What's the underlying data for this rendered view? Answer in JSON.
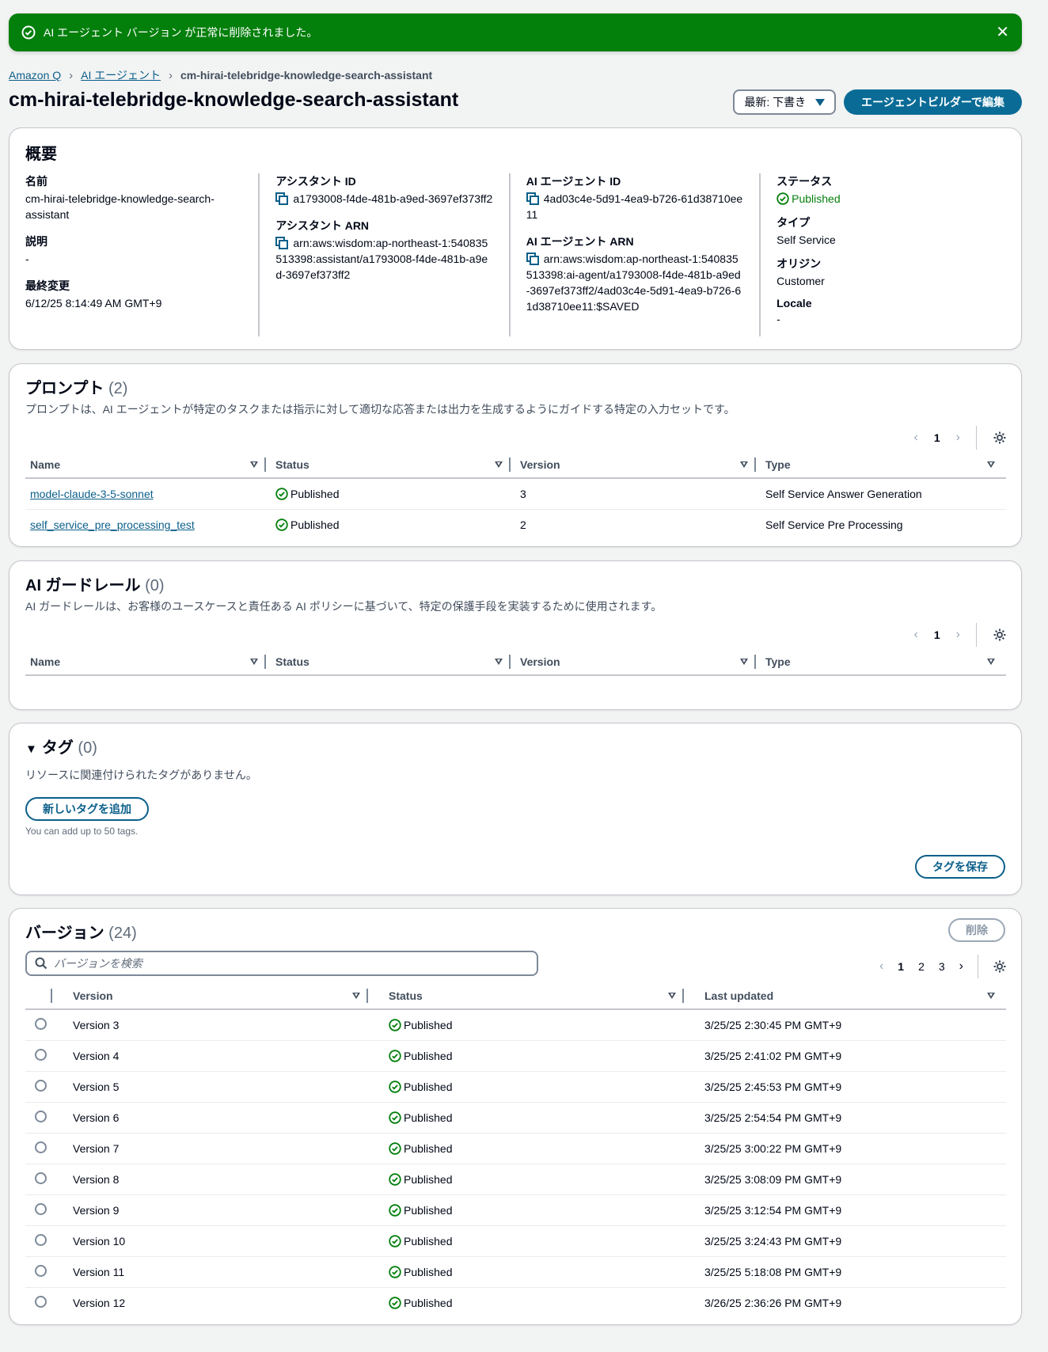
{
  "flash": {
    "message": "AI エージェント バージョン が正常に削除されました。",
    "close": "✕"
  },
  "breadcrumb": {
    "items": [
      "Amazon Q",
      "AI エージェント"
    ],
    "current": "cm-hirai-telebridge-knowledge-search-assistant"
  },
  "header": {
    "title": "cm-hirai-telebridge-knowledge-search-assistant",
    "version_select": "最新: 下書き",
    "edit_button": "エージェントビルダーで編集"
  },
  "overview": {
    "title": "概要",
    "name_label": "名前",
    "name_value": "cm-hirai-telebridge-knowledge-search-assistant",
    "desc_label": "説明",
    "desc_value": "-",
    "modified_label": "最終変更",
    "modified_value": "6/12/25 8:14:49 AM GMT+9",
    "assistant_id_label": "アシスタント ID",
    "assistant_id_value": "a1793008-f4de-481b-a9ed-3697ef373ff2",
    "assistant_arn_label": "アシスタント ARN",
    "assistant_arn_value": "arn:aws:wisdom:ap-northeast-1:540835513398:assistant/a1793008-f4de-481b-a9ed-3697ef373ff2",
    "agent_id_label": "AI エージェント ID",
    "agent_id_value": "4ad03c4e-5d91-4ea9-b726-61d38710ee11",
    "agent_arn_label": "AI エージェント ARN",
    "agent_arn_value": "arn:aws:wisdom:ap-northeast-1:540835513398:ai-agent/a1793008-f4de-481b-a9ed-3697ef373ff2/4ad03c4e-5d91-4ea9-b726-61d38710ee11:$SAVED",
    "status_label": "ステータス",
    "status_value": "Published",
    "type_label": "タイプ",
    "type_value": "Self Service",
    "origin_label": "オリジン",
    "origin_value": "Customer",
    "locale_label": "Locale",
    "locale_value": "-"
  },
  "prompts": {
    "title": "プロンプト",
    "count": "(2)",
    "description": "プロンプトは、AI エージェントが特定のタスクまたは指示に対して適切な応答または出力を生成するようにガイドする特定の入力セットです。",
    "page": "1",
    "columns": [
      "Name",
      "Status",
      "Version",
      "Type"
    ],
    "rows": [
      {
        "name": "model-claude-3-5-sonnet",
        "status": "Published",
        "version": "3",
        "type": "Self Service Answer Generation"
      },
      {
        "name": "self_service_pre_processing_test",
        "status": "Published",
        "version": "2",
        "type": "Self Service Pre Processing"
      }
    ]
  },
  "guardrails": {
    "title": "AI ガードレール",
    "count": "(0)",
    "description": "AI ガードレールは、お客様のユースケースと責任ある AI ポリシーに基づいて、特定の保護手段を実装するために使用されます。",
    "page": "1",
    "columns": [
      "Name",
      "Status",
      "Version",
      "Type"
    ]
  },
  "tags": {
    "title": "タグ",
    "count": "(0)",
    "empty": "リソースに関連付けられたタグがありません。",
    "add_button": "新しいタグを追加",
    "hint": "You can add up to 50 tags.",
    "save_button": "タグを保存"
  },
  "versions": {
    "title": "バージョン",
    "count": "(24)",
    "delete_button": "削除",
    "search_placeholder": "バージョンを検索",
    "pages": [
      "1",
      "2",
      "3"
    ],
    "columns": [
      "Version",
      "Status",
      "Last updated"
    ],
    "rows": [
      {
        "version": "Version 3",
        "status": "Published",
        "updated": "3/25/25 2:30:45 PM GMT+9"
      },
      {
        "version": "Version 4",
        "status": "Published",
        "updated": "3/25/25 2:41:02 PM GMT+9"
      },
      {
        "version": "Version 5",
        "status": "Published",
        "updated": "3/25/25 2:45:53 PM GMT+9"
      },
      {
        "version": "Version 6",
        "status": "Published",
        "updated": "3/25/25 2:54:54 PM GMT+9"
      },
      {
        "version": "Version 7",
        "status": "Published",
        "updated": "3/25/25 3:00:22 PM GMT+9"
      },
      {
        "version": "Version 8",
        "status": "Published",
        "updated": "3/25/25 3:08:09 PM GMT+9"
      },
      {
        "version": "Version 9",
        "status": "Published",
        "updated": "3/25/25 3:12:54 PM GMT+9"
      },
      {
        "version": "Version 10",
        "status": "Published",
        "updated": "3/25/25 3:24:43 PM GMT+9"
      },
      {
        "version": "Version 11",
        "status": "Published",
        "updated": "3/25/25 5:18:08 PM GMT+9"
      },
      {
        "version": "Version 12",
        "status": "Published",
        "updated": "3/26/25 2:36:26 PM GMT+9"
      }
    ]
  },
  "colors": {
    "success": "#037f0c",
    "link": "#0b5f8a",
    "primary": "#0a6c96"
  }
}
